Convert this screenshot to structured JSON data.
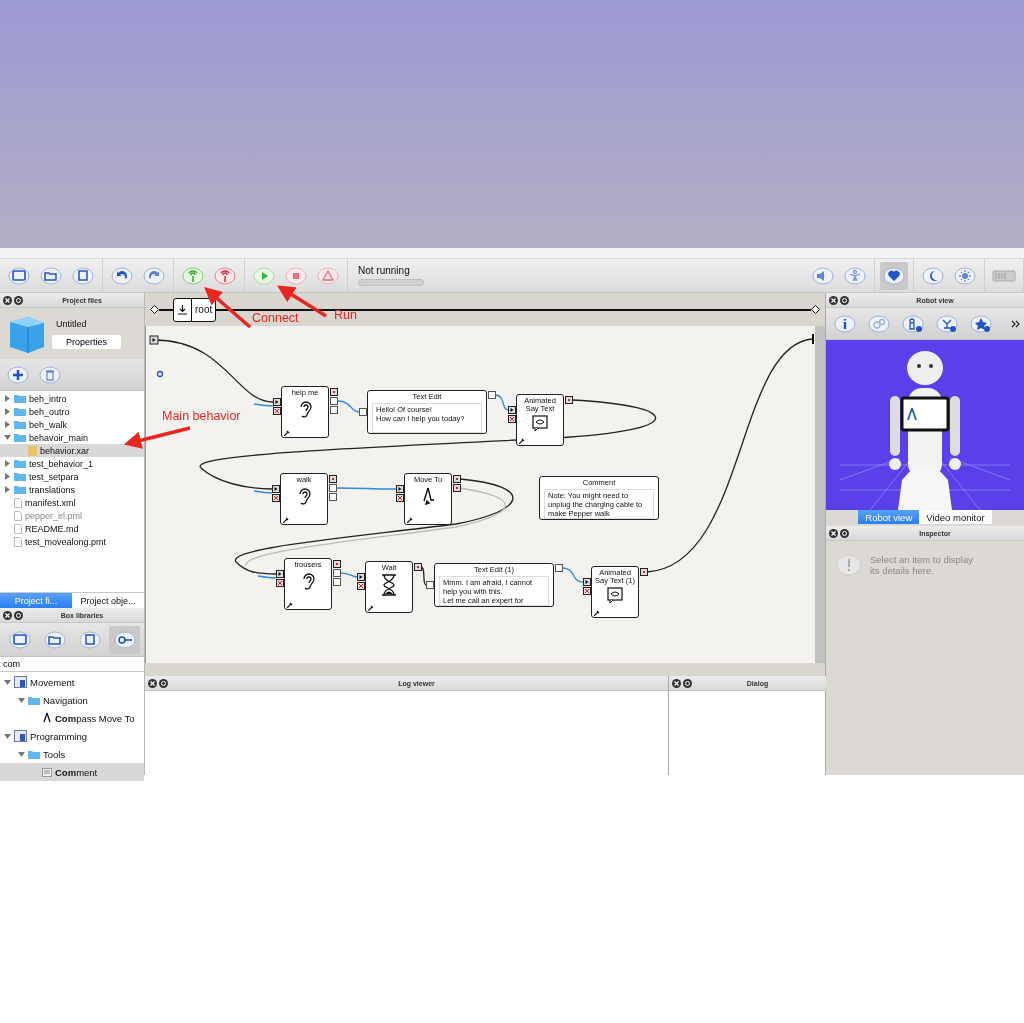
{
  "toolbar": {
    "tool_groups": [
      {
        "tools": [
          {
            "kind": "new",
            "selected": false
          },
          {
            "kind": "open",
            "selected": false
          },
          {
            "kind": "save",
            "selected": false
          }
        ]
      },
      {
        "tools": [
          {
            "kind": "undo",
            "selected": false
          },
          {
            "kind": "redo",
            "selected": false
          }
        ]
      },
      {
        "tools": [
          {
            "kind": "connect",
            "selected": false
          },
          {
            "kind": "disconnect",
            "selected": false
          }
        ]
      },
      {
        "tools": [
          {
            "kind": "play",
            "selected": false
          },
          {
            "kind": "stop",
            "selected": false
          },
          {
            "kind": "warning",
            "selected": false
          }
        ]
      }
    ],
    "status": "Not running",
    "right_groups": [
      {
        "tools": [
          {
            "kind": "volume",
            "selected": false
          },
          {
            "kind": "posture",
            "selected": false
          }
        ]
      },
      {
        "tools": [
          {
            "kind": "heart",
            "selected": true
          }
        ]
      },
      {
        "tools": [
          {
            "kind": "sleep",
            "selected": false
          },
          {
            "kind": "wake",
            "selected": false
          }
        ]
      },
      {
        "tools": [
          {
            "kind": "battery",
            "selected": false
          }
        ]
      }
    ]
  },
  "project_panel": {
    "title": "Project files",
    "project_name": "Untitled",
    "properties_button": "Properties",
    "tools": [
      {
        "kind": "add",
        "selected": false
      },
      {
        "kind": "delete",
        "selected": false
      }
    ],
    "tree": [
      {
        "label": "beh_intro",
        "kind": "folder",
        "expanded": false,
        "selected": false,
        "dimmed": false
      },
      {
        "label": "beh_outro",
        "kind": "folder",
        "expanded": false,
        "selected": false,
        "dimmed": false
      },
      {
        "label": "beh_walk",
        "kind": "folder",
        "expanded": false,
        "selected": false,
        "dimmed": false
      },
      {
        "label": "behavoir_main",
        "kind": "folder",
        "expanded": true,
        "selected": false,
        "dimmed": false,
        "children": [
          {
            "label": "behavior.xar",
            "kind": "behavior",
            "selected": true,
            "dimmed": false
          }
        ]
      },
      {
        "label": "test_behavior_1",
        "kind": "folder",
        "expanded": false,
        "selected": false,
        "dimmed": false
      },
      {
        "label": "test_setpara",
        "kind": "folder",
        "expanded": false,
        "selected": false,
        "dimmed": false
      },
      {
        "label": "translations",
        "kind": "folder",
        "expanded": false,
        "selected": false,
        "dimmed": false
      },
      {
        "label": "manifest.xml",
        "kind": "file",
        "selected": false,
        "dimmed": false
      },
      {
        "label": "pepper_irl.pml",
        "kind": "file",
        "selected": false,
        "dimmed": true
      },
      {
        "label": "README.md",
        "kind": "file",
        "selected": false,
        "dimmed": false
      },
      {
        "label": "test_movealong.pmt",
        "kind": "file",
        "selected": false,
        "dimmed": false
      }
    ],
    "tabs": [
      {
        "label": "Project fi...",
        "selected": true
      },
      {
        "label": "Project obje...",
        "selected": false
      }
    ]
  },
  "box_libraries": {
    "title": "Box libraries",
    "tools": [
      {
        "kind": "new",
        "selected": false
      },
      {
        "kind": "open",
        "selected": false
      },
      {
        "kind": "save",
        "selected": false
      },
      {
        "kind": "search",
        "selected": true
      }
    ],
    "search": {
      "value": "com"
    },
    "tree": [
      {
        "label": "Movement",
        "kind": "library",
        "expanded": true,
        "selected": false,
        "children": [
          {
            "label": "Navigation",
            "kind": "folder",
            "expanded": true,
            "selected": false,
            "children": [
              {
                "label": "**Com**pass Move To",
                "kind": "box",
                "selected": false
              }
            ]
          }
        ]
      },
      {
        "label": "Programming",
        "kind": "library",
        "expanded": true,
        "selected": false,
        "children": [
          {
            "label": "Tools",
            "kind": "folder",
            "expanded": true,
            "selected": false,
            "children": [
              {
                "label": "**Com**ment",
                "kind": "comment",
                "selected": true
              }
            ]
          }
        ]
      }
    ]
  },
  "flow": {
    "breadcrumb": "root",
    "nodes": [
      {
        "kind": "listen",
        "title": "help me",
        "outputs": [
          {
            "kind": "signal"
          },
          {
            "kind": "empty"
          },
          {
            "kind": "empty"
          }
        ]
      },
      {
        "kind": "text",
        "title": "Text Edit",
        "text": "Hello! Of course!\nHow can I help you today?"
      },
      {
        "kind": "say",
        "title": "Animated Say Text",
        "outputs": [
          {
            "kind": "signal"
          }
        ]
      },
      {
        "kind": "listen",
        "title": "walk",
        "outputs": [
          {
            "kind": "signal"
          },
          {
            "kind": "empty"
          },
          {
            "kind": "empty"
          }
        ]
      },
      {
        "kind": "move",
        "title": "Move To",
        "outputs": [
          {
            "kind": "signal"
          },
          {
            "kind": "signal"
          }
        ]
      },
      {
        "kind": "comment",
        "title": "Comment",
        "text": "Note: You might need to\nunplug the charging cable to\nmake Pepper walk"
      },
      {
        "kind": "listen",
        "title": "trousers",
        "outputs": [
          {
            "kind": "signal"
          },
          {
            "kind": "empty"
          },
          {
            "kind": "empty"
          }
        ]
      },
      {
        "kind": "wait",
        "title": "Wait",
        "outputs": [
          {
            "kind": "signal"
          }
        ]
      },
      {
        "kind": "text",
        "title": "Text Edit (1)",
        "text": "Mmm. I am afraid, I cannot\nhelp you with this.\nLet me call an expert for"
      },
      {
        "kind": "say",
        "title": "Animated Say Text (1)",
        "outputs": [
          {
            "kind": "signal"
          }
        ]
      }
    ]
  },
  "log_viewer": {
    "title": "Log viewer"
  },
  "dialog": {
    "title": "Dialog"
  },
  "robot_view": {
    "title": "Robot view",
    "tools": [
      {
        "kind": "info",
        "selected": false
      },
      {
        "kind": "gears",
        "selected": false
      },
      {
        "kind": "robot-off",
        "selected": false
      },
      {
        "kind": "motion-off",
        "selected": false
      },
      {
        "kind": "star-off",
        "selected": false
      }
    ],
    "tabs": [
      {
        "label": "Robot view",
        "selected": true
      },
      {
        "label": "Video monitor",
        "selected": false
      }
    ]
  },
  "inspector": {
    "title": "Inspector",
    "message": "Select an item to display\nits details here."
  },
  "annotations": [
    {
      "text": "Connect"
    },
    {
      "text": "Run"
    },
    {
      "text": "Main behavior"
    }
  ]
}
